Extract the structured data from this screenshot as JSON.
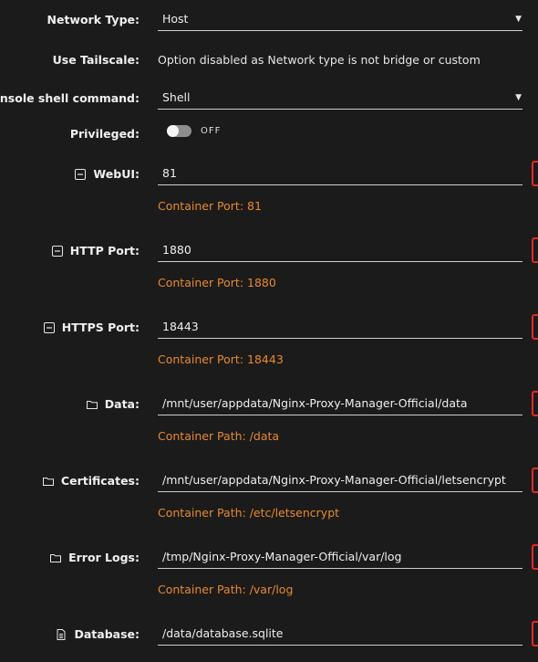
{
  "network_type": {
    "label": "Network Type:",
    "value": "Host"
  },
  "use_tailscale": {
    "label": "Use Tailscale:",
    "value": "Option disabled as Network type is not bridge or custom"
  },
  "console_shell": {
    "label": "Console shell command:",
    "value": "Shell"
  },
  "privileged": {
    "label": "Privileged:",
    "state": "OFF",
    "enabled": false
  },
  "webui": {
    "label": "WebUI:",
    "value": "81",
    "hint": "Container Port: 81",
    "icon": "minus-square-icon"
  },
  "http_port": {
    "label": "HTTP Port:",
    "value": "1880",
    "hint": "Container Port: 1880",
    "icon": "minus-square-icon"
  },
  "https_port": {
    "label": "HTTPS Port:",
    "value": "18443",
    "hint": "Container Port: 18443",
    "icon": "minus-square-icon"
  },
  "data_path": {
    "label": "Data:",
    "value": "/mnt/user/appdata/Nginx-Proxy-Manager-Official/data",
    "hint": "Container Path: /data",
    "icon": "folder-icon"
  },
  "certificates": {
    "label": "Certificates:",
    "value": "/mnt/user/appdata/Nginx-Proxy-Manager-Official/letsencrypt",
    "hint": "Container Path: /etc/letsencrypt",
    "icon": "folder-icon"
  },
  "error_logs": {
    "label": "Error Logs:",
    "value": "/tmp/Nginx-Proxy-Manager-Official/var/log",
    "hint": "Container Path: /var/log",
    "icon": "folder-icon"
  },
  "database": {
    "label": "Database:",
    "value": "/data/database.sqlite",
    "icon": "file-icon"
  },
  "colors": {
    "hint": "#e68a2e",
    "edit_border": "#e22828",
    "background": "#1c1b1b"
  }
}
